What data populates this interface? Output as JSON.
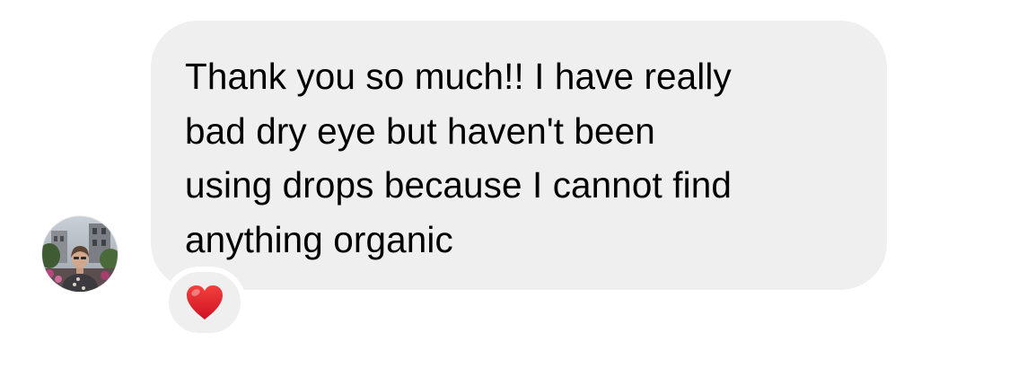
{
  "message": {
    "text": "Thank you so much!! I have really\nbad dry eye but haven't been\nusing drops because I cannot find\nanything organic",
    "bubble_color": "#efefef",
    "text_color": "#000000"
  },
  "sender": {
    "avatar_icon": "profile-photo"
  },
  "reaction": {
    "icon": "red-heart-icon",
    "color": "#e0192d"
  }
}
